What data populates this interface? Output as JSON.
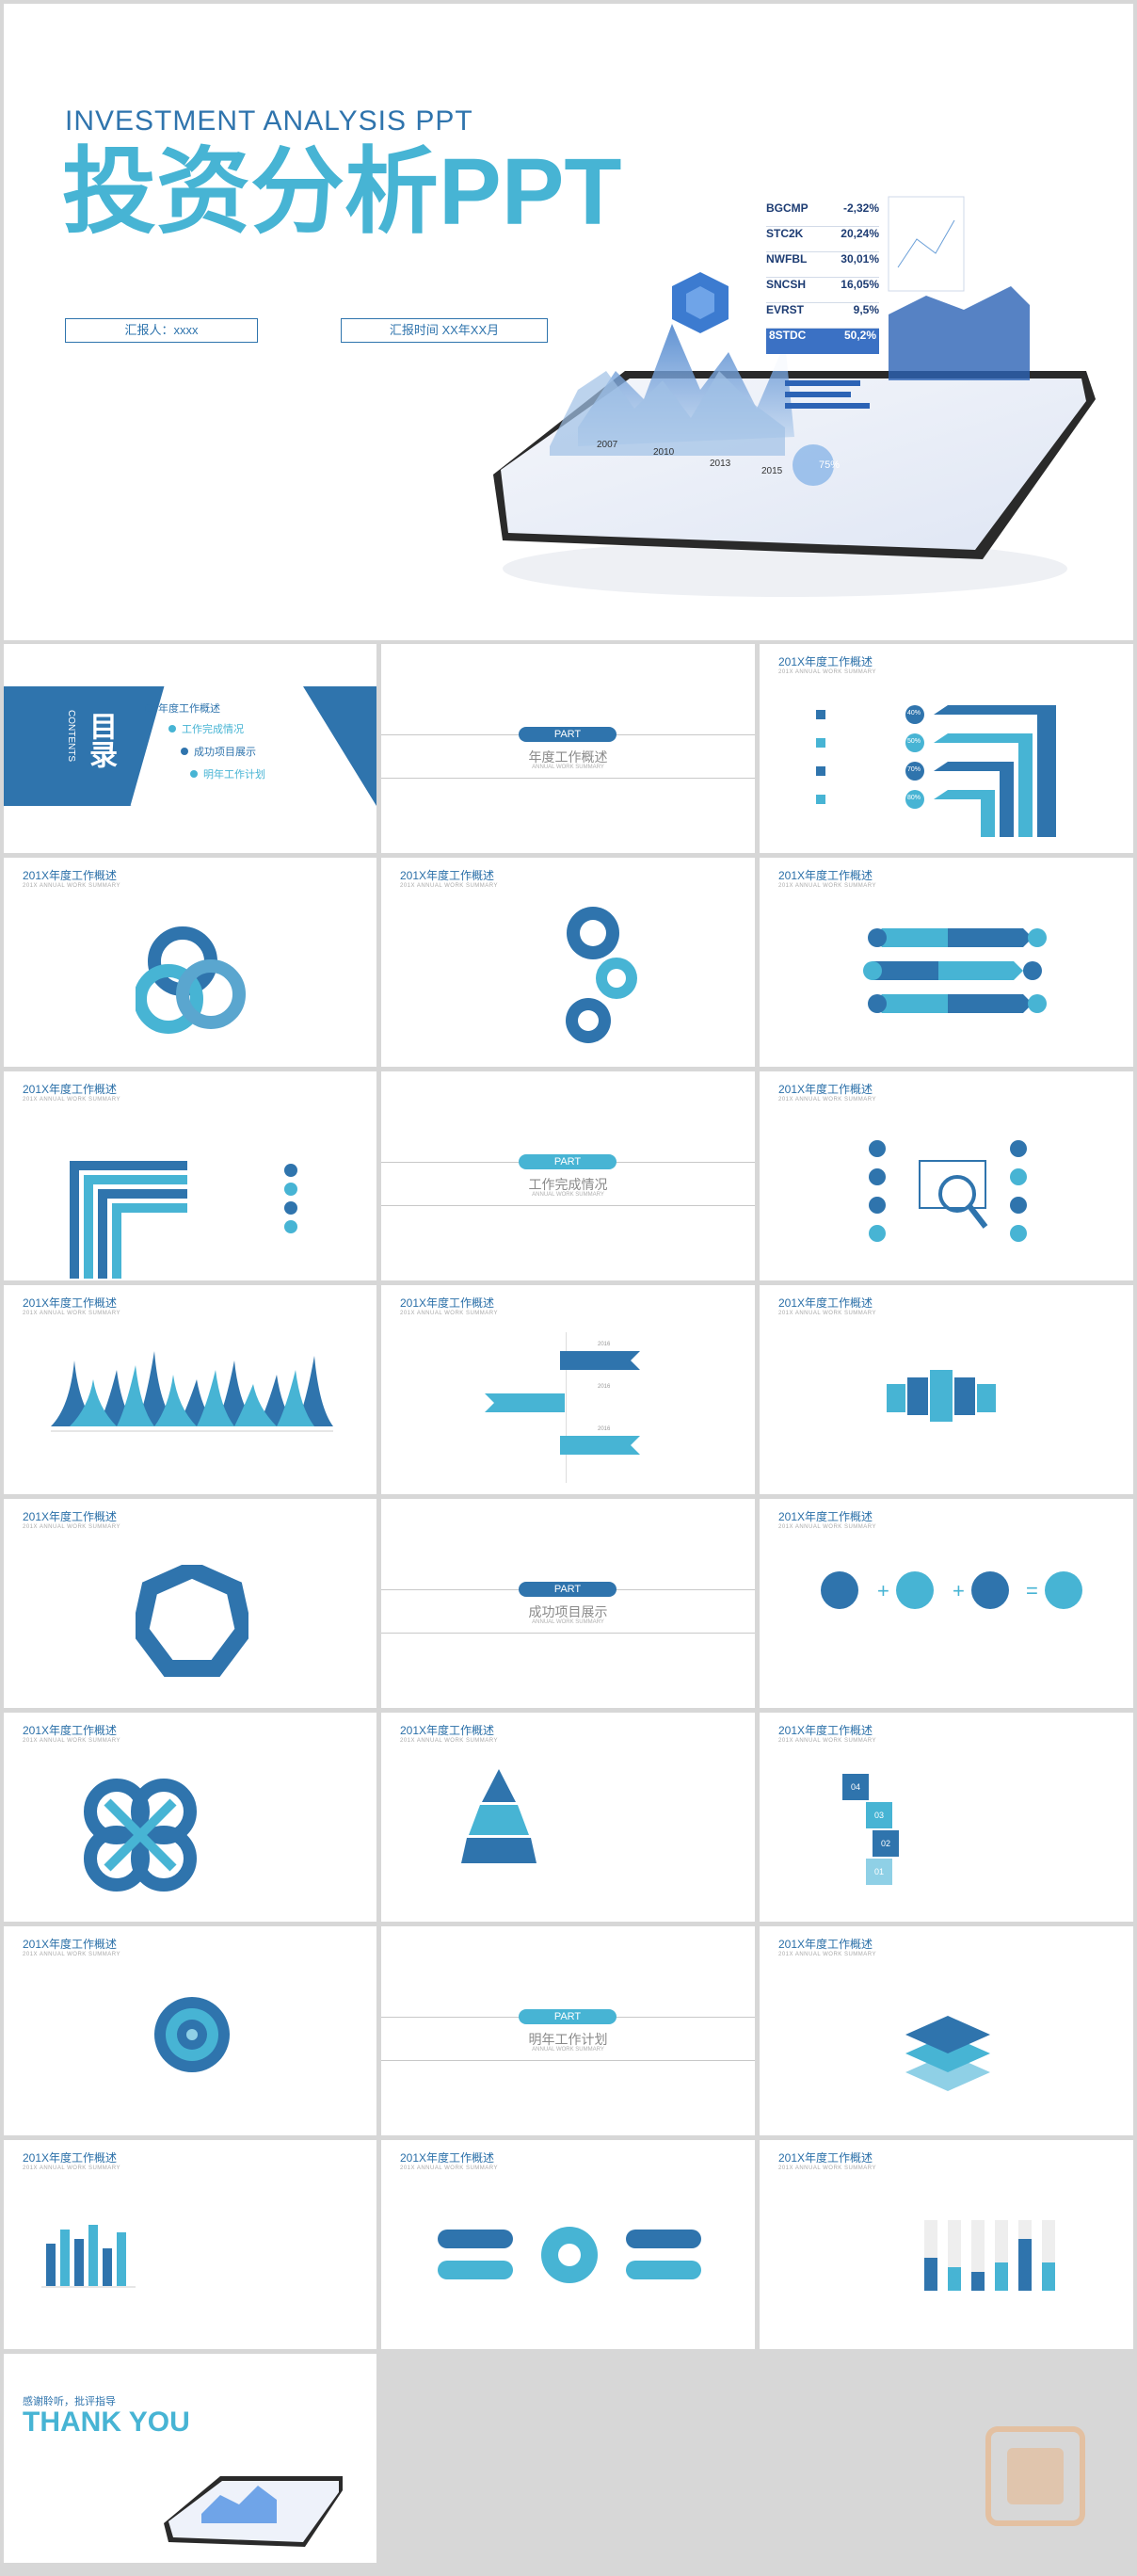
{
  "cover": {
    "title_en": "INVESTMENT ANALYSIS PPT",
    "title_cn": "投资分析PPT",
    "reporter_label": "汇报人：xxxx",
    "time_label": "汇报时间 XX年XX月",
    "tickers": [
      {
        "name": "BGCMP",
        "value": "-2,32%"
      },
      {
        "name": "STC2K",
        "value": "20,24%"
      },
      {
        "name": "NWFBL",
        "value": "30,01%"
      },
      {
        "name": "SNCSH",
        "value": "16,05%"
      },
      {
        "name": "EVRST",
        "value": "9,5%"
      },
      {
        "name": "8STDC",
        "value": "50,2%"
      }
    ],
    "years": [
      "2007",
      "2010",
      "2013",
      "2015"
    ],
    "gauge": "75%"
  },
  "toc": {
    "title": "目录",
    "title_en": "CONTENTS",
    "items": [
      "年度工作概述",
      "工作完成情况",
      "成功项目展示",
      "明年工作计划"
    ]
  },
  "common": {
    "slide_title": "201X年度工作概述",
    "slide_sub": "201X ANNUAL WORK SUMMARY"
  },
  "parts": [
    {
      "label": "PART",
      "title": "年度工作概述",
      "sub": "ANNUAL WORK SUMMARY"
    },
    {
      "label": "PART",
      "title": "工作完成情况",
      "sub": "ANNUAL WORK SUMMARY"
    },
    {
      "label": "PART",
      "title": "成功项目展示",
      "sub": "ANNUAL WORK SUMMARY"
    },
    {
      "label": "PART",
      "title": "明年工作计划",
      "sub": "ANNUAL WORK SUMMARY"
    }
  ],
  "percent_labels": [
    "40%",
    "50%",
    "70%",
    "80%"
  ],
  "step_numbers": [
    "04",
    "03",
    "02",
    "01"
  ],
  "years_timeline": [
    "2016",
    "2016",
    "2016"
  ],
  "thankyou": {
    "small": "感谢聆听，批评指导",
    "big": "THANK YOU"
  },
  "colors": {
    "primary": "#2f74ad",
    "accent": "#47b4d4",
    "light": "#8fd0e6"
  }
}
